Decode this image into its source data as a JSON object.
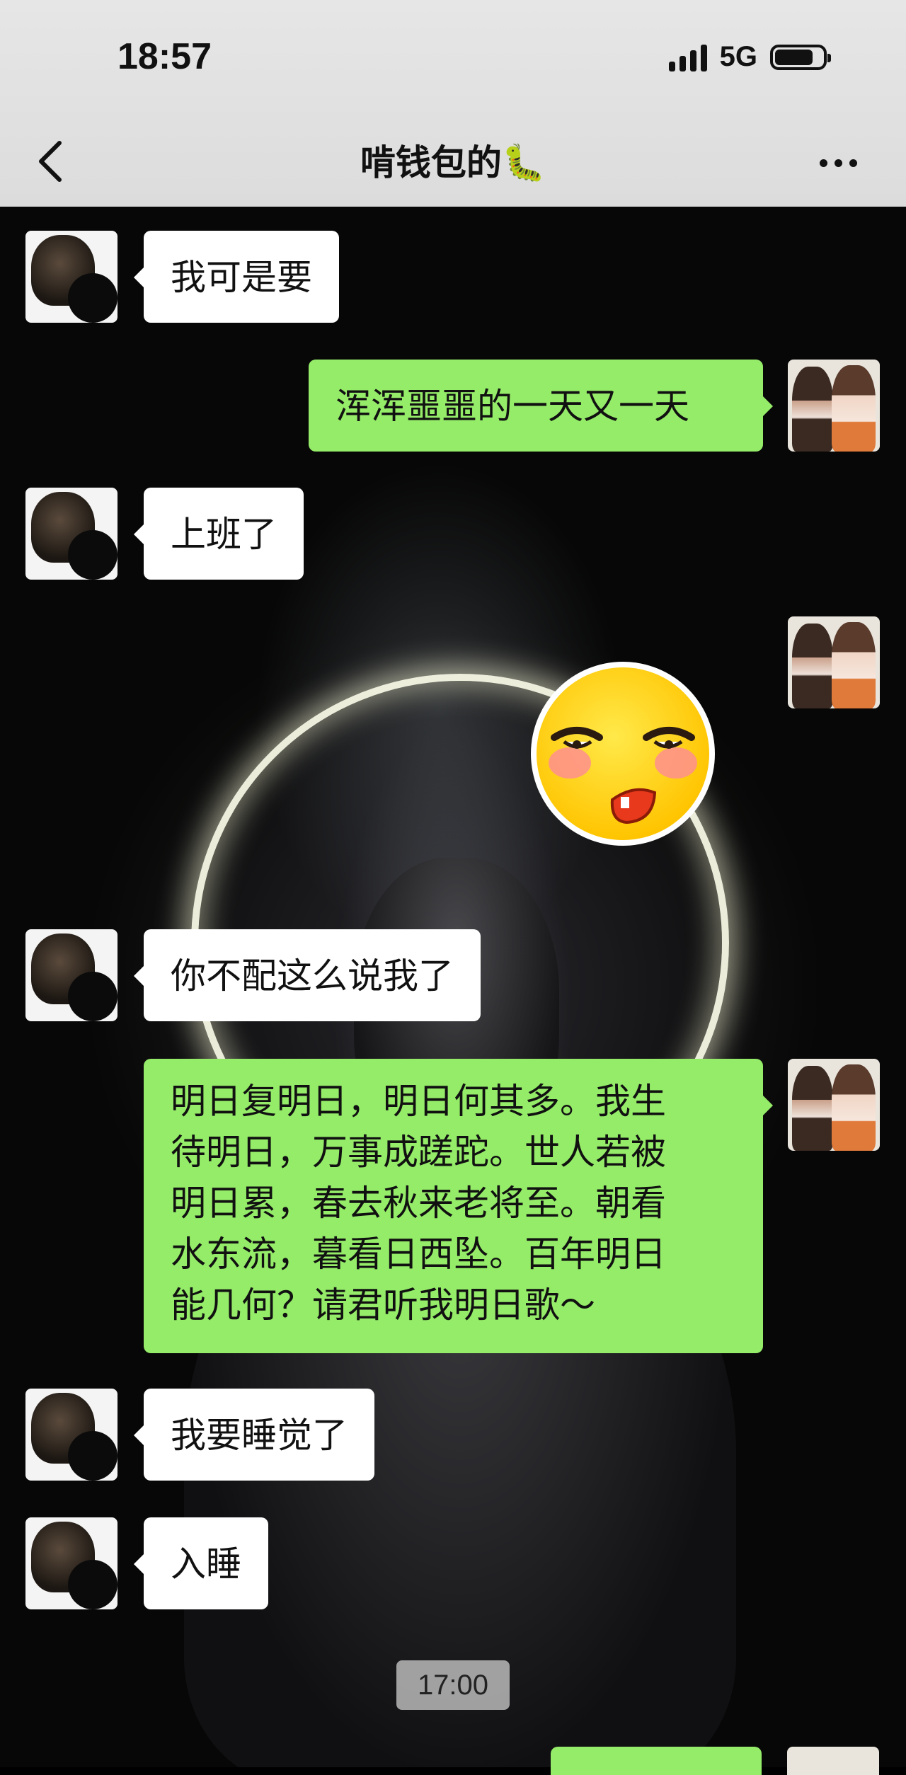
{
  "status_bar": {
    "time": "18:57",
    "network": "5G",
    "battery_level": 0.8
  },
  "header": {
    "title": "啃钱包的🐛",
    "back_icon": "chevron-left-icon",
    "more_icon": "more-dots-icon"
  },
  "colors": {
    "header_bg": "#e2e2e2",
    "outgoing_bubble": "#95ec69",
    "incoming_bubble": "#ffffff",
    "chat_bg": "#0a0a0a"
  },
  "messages": [
    {
      "side": "left",
      "text": "我可是要"
    },
    {
      "side": "right",
      "text": "浑浑噩噩的一天又一天"
    },
    {
      "side": "left",
      "text": "上班了"
    },
    {
      "side": "right",
      "type": "sticker",
      "sticker": "smirk-emoji-sticker"
    },
    {
      "side": "left",
      "text": "你不配这么说我了"
    },
    {
      "side": "right",
      "lines": [
        "明日复明日，明日何其多。我生",
        "待明日，万事成蹉跎。世人若被",
        "明日累，春去秋来老将至。朝看",
        "水东流，暮看日西坠。百年明日",
        "能几何？请君听我明日歌～"
      ]
    },
    {
      "side": "left",
      "text": "我要睡觉了"
    },
    {
      "side": "left",
      "text": "入睡"
    }
  ],
  "timestamp": "17:00"
}
